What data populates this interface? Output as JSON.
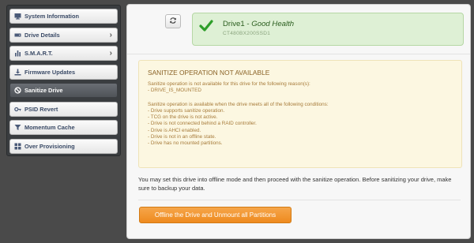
{
  "sidebar": {
    "items": [
      {
        "label": "System Information",
        "icon": "monitor-icon",
        "chevron": false,
        "active": false
      },
      {
        "label": "Drive Details",
        "icon": "drive-icon",
        "chevron": true,
        "active": false
      },
      {
        "label": "S.M.A.R.T.",
        "icon": "bar-chart-icon",
        "chevron": true,
        "active": false
      },
      {
        "label": "Firmware Updates",
        "icon": "download-icon",
        "chevron": false,
        "active": false
      },
      {
        "label": "Sanitize Drive",
        "icon": "prohibit-icon",
        "chevron": false,
        "active": true
      },
      {
        "label": "PSID Revert",
        "icon": "key-icon",
        "chevron": false,
        "active": false
      },
      {
        "label": "Momentum Cache",
        "icon": "funnel-icon",
        "chevron": false,
        "active": false
      },
      {
        "label": "Over Provisioning",
        "icon": "grid-icon",
        "chevron": false,
        "active": false
      }
    ]
  },
  "drive": {
    "name": "Drive1",
    "separator": " - ",
    "health": "Good Health",
    "model": "CT480BX200SSD1",
    "status_color": "#2e9e2a"
  },
  "warning": {
    "title": "SANITIZE OPERATION NOT AVAILABLE",
    "reason_intro": "Sanitize operation is not available for this drive for the following reason(s):",
    "reasons": [
      "- DRIVE_IS_MOUNTED"
    ],
    "conditions_intro": "Sanitize operation is available when the drive meets all of the following conditions:",
    "conditions": [
      "- Drive supports sanitize operation.",
      "- TCG on the drive is not active.",
      "- Drive is not connected behind a RAID controller.",
      "- Drive is AHCI enabled.",
      "- Drive is not in an offline state.",
      "- Drive has no mounted partitions."
    ]
  },
  "info": {
    "text": "You may set this drive into offline mode and then proceed with the sanitize operation. Before sanitizing your drive, make sure to backup your data."
  },
  "actions": {
    "offline_label": "Offline the Drive and Unmount all Partitions",
    "accent": "#f0932b"
  }
}
